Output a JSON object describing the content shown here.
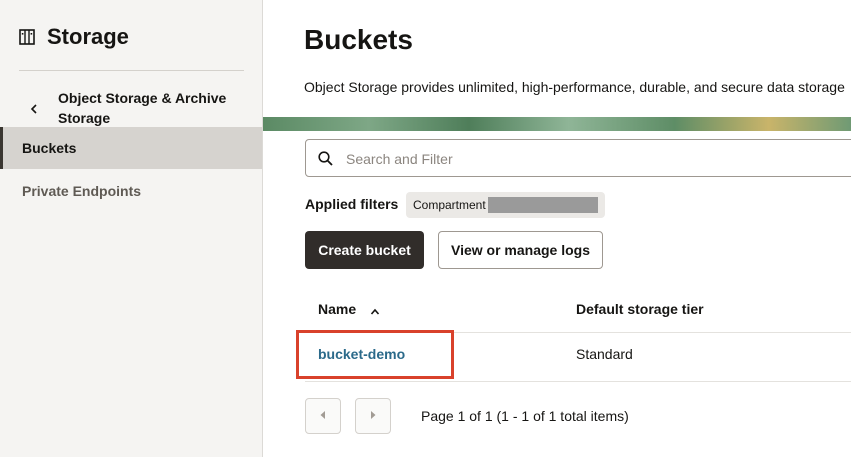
{
  "sidebar": {
    "title": "Storage",
    "back_label": "Object Storage & Archive Storage",
    "items": [
      {
        "label": "Buckets"
      },
      {
        "label": "Private Endpoints"
      }
    ]
  },
  "main": {
    "title": "Buckets",
    "description": "Object Storage provides unlimited, high-performance, durable, and secure data storage",
    "search": {
      "placeholder": "Search and Filter"
    },
    "filters": {
      "label": "Applied filters",
      "chip_label": "Compartment"
    },
    "buttons": {
      "create": "Create bucket",
      "logs": "View or manage logs"
    },
    "table": {
      "columns": [
        "Name",
        "Default storage tier"
      ],
      "rows": [
        {
          "name": "bucket-demo",
          "tier": "Standard"
        }
      ]
    },
    "pagination": {
      "info": "Page 1 of 1 (1 - 1 of 1 total items)"
    }
  },
  "colors": {
    "accent_link": "#2b6a8a",
    "highlight": "#d9412b",
    "primary_button": "#312d2a"
  },
  "icons": [
    "storage-icon",
    "chevron-left-icon",
    "search-icon",
    "sort-ascending-icon",
    "pager-prev-icon",
    "pager-next-icon"
  ]
}
